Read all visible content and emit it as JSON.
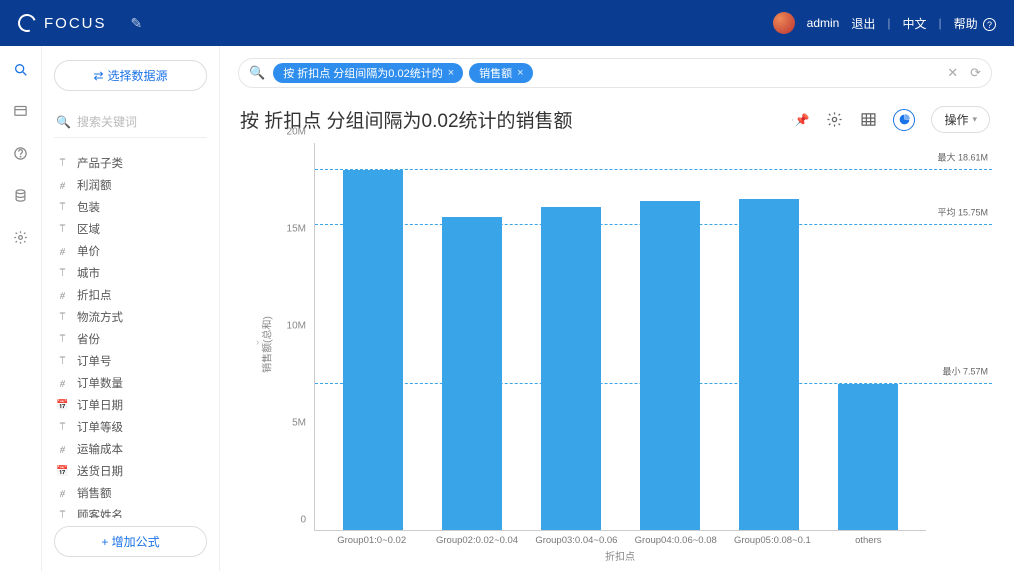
{
  "header": {
    "brand": "FOCUS",
    "user": "admin",
    "logout": "退出",
    "lang": "中文",
    "help": "帮助"
  },
  "sidebar": {
    "select_ds": "选择数据源",
    "search_placeholder": "搜索关键词",
    "add_formula": "增加公式",
    "fields": [
      {
        "icon": "T",
        "label": "产品子类"
      },
      {
        "icon": "#",
        "label": "利润额"
      },
      {
        "icon": "T",
        "label": "包装"
      },
      {
        "icon": "T",
        "label": "区域"
      },
      {
        "icon": "#",
        "label": "单价"
      },
      {
        "icon": "T",
        "label": "城市"
      },
      {
        "icon": "#",
        "label": "折扣点"
      },
      {
        "icon": "T",
        "label": "物流方式"
      },
      {
        "icon": "T",
        "label": "省份"
      },
      {
        "icon": "T",
        "label": "订单号"
      },
      {
        "icon": "#",
        "label": "订单数量"
      },
      {
        "icon": "D",
        "label": "订单日期"
      },
      {
        "icon": "T",
        "label": "订单等级"
      },
      {
        "icon": "#",
        "label": "运输成本"
      },
      {
        "icon": "D",
        "label": "送货日期"
      },
      {
        "icon": "#",
        "label": "销售额"
      },
      {
        "icon": "T",
        "label": "顾客姓名"
      }
    ]
  },
  "query": {
    "chips": [
      "按 折扣点 分组间隔为0.02统计的",
      "销售额"
    ]
  },
  "title": "按 折扣点 分组间隔为0.02统计的销售额",
  "ops_label": "操作",
  "chart_data": {
    "type": "bar",
    "categories": [
      "Group01:0~0.02",
      "Group02:0.02~0.04",
      "Group03:0.04~0.06",
      "Group04:0.06~0.08",
      "Group05:0.08~0.1",
      "others"
    ],
    "values": [
      18610000,
      16200000,
      16700000,
      17000000,
      17100000,
      7570000
    ],
    "xlabel": "折扣点",
    "ylabel": "销售额(总和)",
    "ylim": [
      0,
      20000000
    ],
    "y_ticks": [
      0,
      5000000,
      10000000,
      15000000,
      20000000
    ],
    "y_tick_labels": [
      "0",
      "5M",
      "10M",
      "15M",
      "20M"
    ],
    "reference_lines": [
      {
        "label": "最大 18.61M",
        "value": 18610000
      },
      {
        "label": "平均 15.75M",
        "value": 15750000
      },
      {
        "label": "最小 7.57M",
        "value": 7570000
      }
    ]
  }
}
